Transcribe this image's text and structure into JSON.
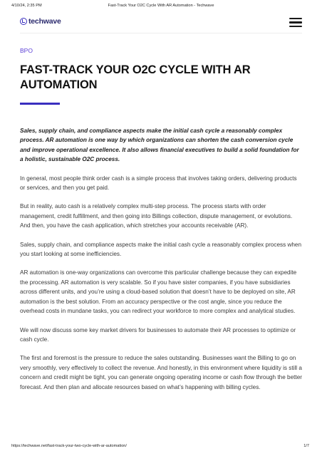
{
  "print_header": {
    "datetime": "4/10/24, 2:35 PM",
    "doc_title": "Fast-Track Your O2C Cycle With AR Automation - Techwave"
  },
  "site": {
    "logo_text": "techwave",
    "logo_icon": "techwave-logo-icon",
    "menu_icon": "hamburger-menu-icon",
    "accent_color": "#3a2fbf"
  },
  "article": {
    "category": "BPO",
    "title": "FAST-TRACK YOUR O2C CYCLE WITH AR AUTOMATION",
    "intro": "Sales, supply chain, and compliance aspects make the initial cash cycle a reasonably complex process.  AR automation is one way by which organizations can shorten the cash conversion cycle and improve operational excellence. It also allows financial executives to build a solid foundation for a holistic, sustainable O2C process.",
    "paragraphs": [
      "In general, most people think order cash is a simple process that involves taking orders, delivering products or services, and then you get paid.",
      "But in reality, auto cash is a relatively complex multi-step process. The process starts with order management, credit fulfillment, and then going into Billings collection, dispute management, or evolutions. And then, you have the cash application, which stretches your accounts receivable (AR).",
      "Sales, supply chain, and compliance aspects make the initial cash cycle a reasonably complex process when you start looking at some inefficiencies.",
      "AR automation is one-way organizations can overcome this particular challenge because they can expedite the processing. AR automation is very scalable. So if you have sister companies, if you have subsidiaries across different units, and you’re using a cloud-based solution that doesn’t have to be deployed on site, AR automation is the best solution. From an accuracy perspective or the cost angle, since you reduce the overhead costs in mundane tasks, you can redirect your workforce to more complex and analytical studies.",
      "We will now discuss some key market drivers for businesses to automate their AR processes to optimize or cash cycle.",
      "The first and foremost is the pressure to reduce the sales outstanding. Businesses want the Billing to go on very smoothly, very effectively to collect the revenue. And honestly, in this environment where liquidity is still a concern and credit might be tight, you can generate ongoing operating income or cash flow through the better forecast. And then plan and allocate resources based on what’s happening with billing cycles."
    ]
  },
  "print_footer": {
    "url": "https://techwave.net/fast-track-your-two-cycle-with-ar-automation/",
    "page": "1/7"
  }
}
